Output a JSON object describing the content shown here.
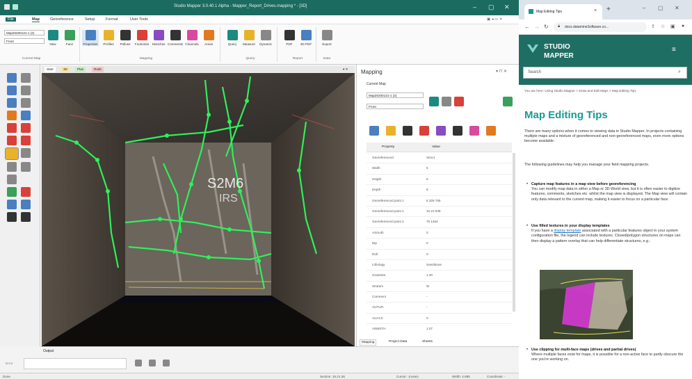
{
  "app": {
    "title": "Studio Mapper 3.0.40.1 Alpha - Mapper_Report_Drives.mapping * - [3D]",
    "menu": [
      "File",
      "Map",
      "Georeference",
      "Setup",
      "Format",
      "User Tools"
    ],
    "ribbon": {
      "map_combo": "Map20200131-1 (2)",
      "face_combo": "Front",
      "buttons": [
        "New",
        "Face",
        "Properties",
        "Profiles",
        "Polluss",
        "Footnotes",
        "Sketches",
        "Comments",
        "Channels",
        "Areas",
        "Query",
        "Measure",
        "Dynamic",
        "PDF",
        "3D PDF",
        "Export"
      ],
      "groups": [
        "Current Map",
        "Mapping",
        "Query",
        "Report",
        "Data"
      ]
    },
    "view_tabs": [
      "Start",
      "3D",
      "Plan",
      "Rods"
    ],
    "mapping_panel": {
      "title": "Mapping",
      "current_map_label": "Current Map",
      "map_value": "Map20200131-1 (2)",
      "face_value": "Front",
      "table_headers": [
        "Property",
        "Value"
      ],
      "rows": [
        [
          "Georeferenced",
          "Struct"
        ],
        [
          "Width",
          "5"
        ],
        [
          "Height",
          "5"
        ],
        [
          "Depth",
          "5"
        ],
        [
          "Georeferenced point 1",
          "6 328 765"
        ],
        [
          "Georeferenced point 1",
          "15 21 039"
        ],
        [
          "Georeferenced point 2",
          "75 1464"
        ],
        [
          "Azimuth",
          "0"
        ],
        [
          "Dip",
          "0"
        ],
        [
          "Roll",
          "0"
        ],
        [
          "Lithology",
          "Sandstone"
        ],
        [
          "Grainsize",
          "1.30"
        ],
        [
          "Stratum",
          "W"
        ],
        [
          "Comment",
          "-"
        ],
        [
          "AUTUFI",
          "-"
        ],
        [
          "AUACC",
          "0"
        ],
        [
          "ANMSTH",
          "1.07"
        ]
      ],
      "bottom_tabs": [
        "Mapping",
        "Project Data",
        "Sheets"
      ]
    },
    "output": {
      "title": "Output",
      "label": "Error"
    },
    "status": {
      "left": "Done",
      "section": "Section: 15.21.36",
      "cursor": "Cursor: -(none)-",
      "width": "Width: 4.885",
      "coord": "Coordinate: -"
    },
    "view_labels": [
      "S2M6",
      "IRS"
    ],
    "colors": {
      "titlebar": "#1c6b61",
      "accent": "#1a9a93",
      "marking": "#2ff05a"
    }
  },
  "browser": {
    "tab_title": "Map Editing Tips",
    "url": "docs.datamineSoftware.co...",
    "site_name_1": "STUDIO",
    "site_name_2": "MAPPER",
    "search_placeholder": "Search",
    "breadcrumb": "You are here: Using Studio Mapper > Draw and Edit Maps > Map Editing Tips",
    "heading": "Map Editing Tips",
    "intro_1": "There are many options when it comes to viewing data in Studio Mapper. In projects containing multiple maps and a mixture of georeferenced and non-georeferenced maps, even more options become available.",
    "intro_2": "The following guidelines may help you manage your field mapping projects.",
    "bullet_1_title": "Capture map features in a map view before georeferencing",
    "bullet_1_body": "You can modify map data in either a Map or 3D World view, but it is often easier to digitize features, comments, sketches etc. whilst the map view is displayed. The Map view will contain only data relevant to the current map, making it easier to focus on a particular face.",
    "bullet_2_title": "Use filled textures in your display templates",
    "bullet_2_pre": "If you have a ",
    "bullet_2_link": "display template",
    "bullet_2_body": " associated with a particular features object in your system configuration file, the legend can include textures. Closed/polygon structures on maps can then display a pattern overlay that can help differentiate structures, e.g.:",
    "bullet_3_title": "Use clipping for multi-face maps (drives and partial drives)",
    "bullet_3_body": "Where multiple faces exist for maps, it is possible for a non-active face to partly obscure the one you're working on."
  }
}
